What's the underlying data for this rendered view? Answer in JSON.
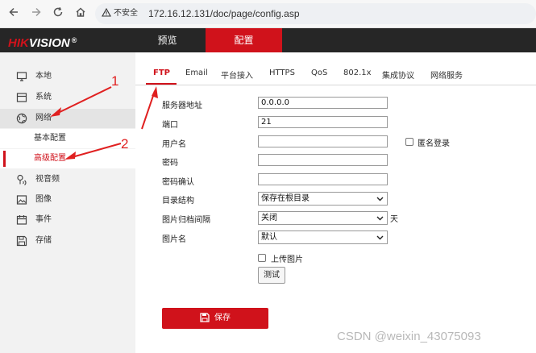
{
  "browser": {
    "security_warning": "不安全",
    "url": "172.16.12.131/doc/page/config.asp"
  },
  "header": {
    "logo_red": "HIK",
    "logo_white": "VISION",
    "logo_reg": "®",
    "tabs": {
      "preview": "预览",
      "config": "配置"
    }
  },
  "sidebar": {
    "local": "本地",
    "system": "系统",
    "network": "网络",
    "network_basic": "基本配置",
    "network_advanced": "高级配置",
    "video_audio": "视音频",
    "image": "图像",
    "event": "事件",
    "storage": "存储"
  },
  "tabs": [
    "FTP",
    "Email",
    "平台接入",
    "HTTPS",
    "QoS",
    "802.1x",
    "集成协议",
    "网络服务"
  ],
  "form": {
    "server_address_label": "服务器地址",
    "server_address_value": "0.0.0.0",
    "port_label": "端口",
    "port_value": "21",
    "username_label": "用户名",
    "username_value": "",
    "anonymous_label": "匿名登录",
    "password_label": "密码",
    "password_confirm_label": "密码确认",
    "dir_structure_label": "目录结构",
    "dir_structure_value": "保存在根目录",
    "archive_interval_label": "图片归档间隔",
    "archive_interval_value": "关闭",
    "archive_interval_unit": "天",
    "image_name_label": "图片名",
    "image_name_value": "默认",
    "upload_image_label": "上传图片",
    "test_label": "测试",
    "save_label": "保存"
  },
  "annotations": {
    "one": "1",
    "two": "2"
  },
  "watermark": "CSDN @weixin_43075093",
  "colors": {
    "accent": "#d0121b",
    "header_bg": "#262626",
    "sidebar_bg": "#f2f2f2",
    "annotation": "#e02020"
  }
}
